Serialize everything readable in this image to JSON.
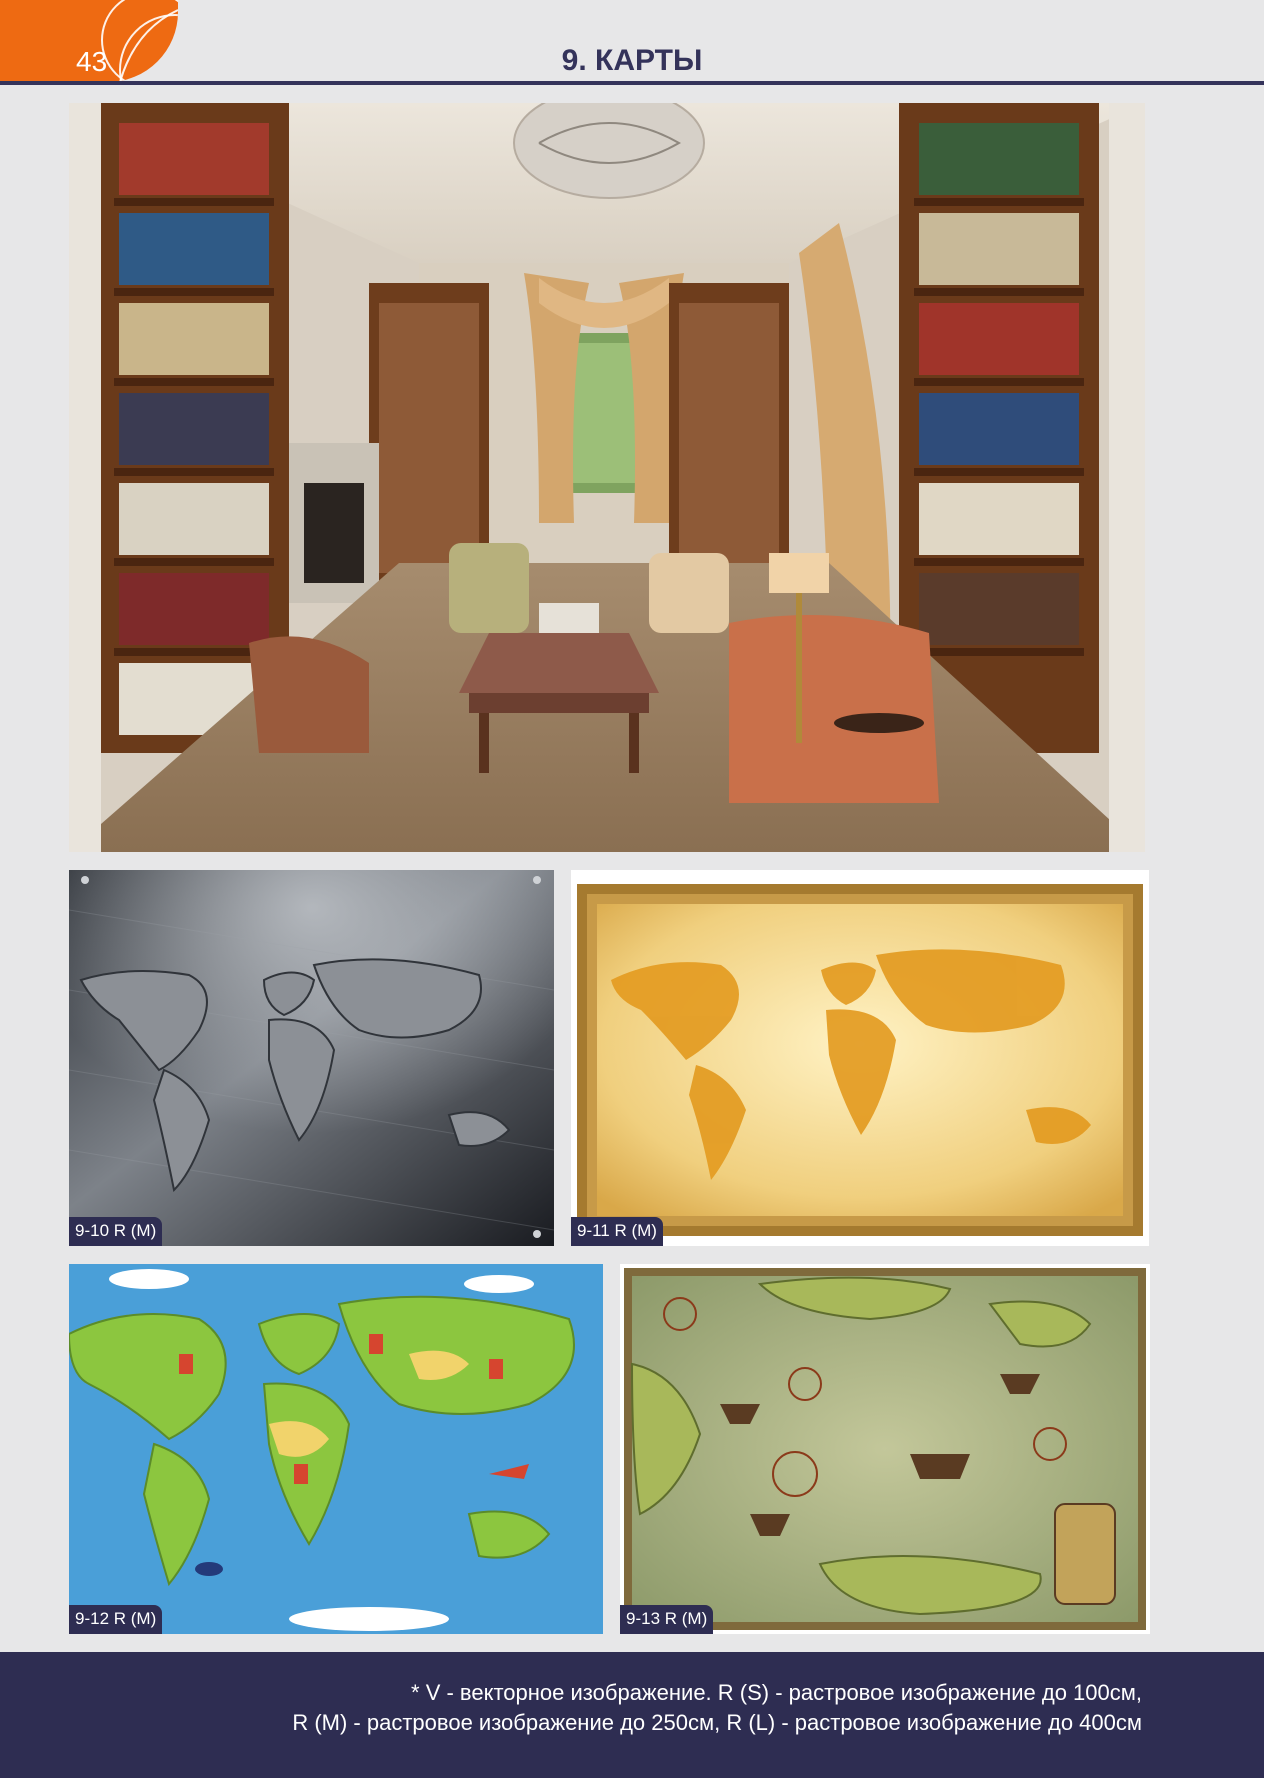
{
  "header": {
    "page_number": "43",
    "title": "9. КАРТЫ"
  },
  "photos": [
    {
      "code": ""
    },
    {
      "code": "9-10 R (M)"
    },
    {
      "code": "9-11 R (M)"
    },
    {
      "code": "9-12 R (M)"
    },
    {
      "code": "9-13 R (M)"
    }
  ],
  "footer": {
    "line1": "* V - векторное изображение. R (S) - растровое изображение до 100см,",
    "line2": "R (M) - растровое изображение до 250см, R (L) - растровое изображение до 400см"
  },
  "colors": {
    "accent_orange": "#ee6a12",
    "navy": "#2e2d52",
    "page_bg": "#e7e7e8"
  }
}
